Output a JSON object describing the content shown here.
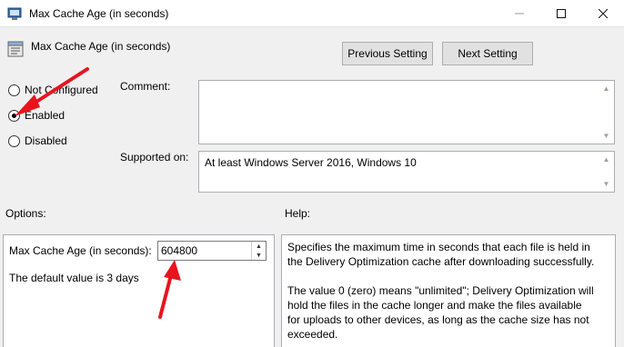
{
  "window": {
    "title": "Max Cache Age (in seconds)",
    "controls": [
      "minimize-icon",
      "maximize-icon",
      "close-icon"
    ]
  },
  "header": {
    "title": "Max Cache Age (in seconds)",
    "prev_label": "Previous Setting",
    "next_label": "Next Setting"
  },
  "state": {
    "options": [
      {
        "label": "Not Configured",
        "selected": false
      },
      {
        "label": "Enabled",
        "selected": true
      },
      {
        "label": "Disabled",
        "selected": false
      }
    ]
  },
  "comment": {
    "label": "Comment:",
    "value": ""
  },
  "supported": {
    "label": "Supported on:",
    "value": "At least Windows Server 2016, Windows 10"
  },
  "options_section": {
    "label": "Options:",
    "field_label": "Max Cache Age (in seconds):",
    "field_value": "604800",
    "default_note": "The default value is 3 days"
  },
  "help_section": {
    "label": "Help:",
    "paragraphs": [
      "Specifies the maximum time in seconds that each file is held in the Delivery Optimization cache after downloading successfully.",
      "The value 0 (zero) means \"unlimited\"; Delivery Optimization will hold the files in the cache longer and make the files available for uploads to other devices, as long as the cache size has not exceeded."
    ]
  },
  "annotation_color": "#e8141e"
}
